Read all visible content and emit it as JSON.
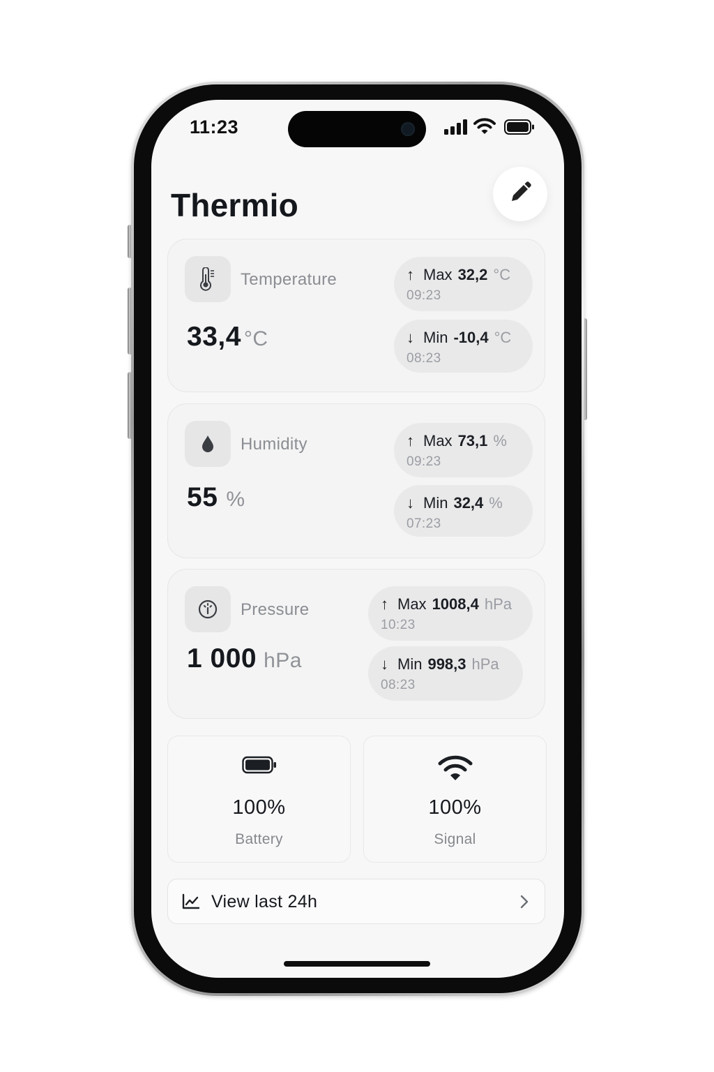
{
  "status_bar": {
    "time": "11:23"
  },
  "header": {
    "title": "Thermio",
    "edit_icon": "pencil-icon"
  },
  "metrics": {
    "temperature": {
      "label": "Temperature",
      "icon": "thermometer-icon",
      "value": "33,4",
      "unit": "°C",
      "max": {
        "label": "Max",
        "value": "32,2",
        "unit": "°C",
        "time": "09:23"
      },
      "min": {
        "label": "Min",
        "value": "-10,4",
        "unit": "°C",
        "time": "08:23"
      }
    },
    "humidity": {
      "label": "Humidity",
      "icon": "droplet-icon",
      "value": "55",
      "unit": "%",
      "max": {
        "label": "Max",
        "value": "73,1",
        "unit": "%",
        "time": "09:23"
      },
      "min": {
        "label": "Min",
        "value": "32,4",
        "unit": "%",
        "time": "07:23"
      }
    },
    "pressure": {
      "label": "Pressure",
      "icon": "gauge-icon",
      "value": "1 000",
      "unit": "hPa",
      "max": {
        "label": "Max",
        "value": "1008,4",
        "unit": "hPa",
        "time": "10:23"
      },
      "min": {
        "label": "Min",
        "value": "998,3",
        "unit": "hPa",
        "time": "08:23"
      }
    }
  },
  "device": {
    "battery": {
      "value": "100%",
      "label": "Battery",
      "icon": "battery-icon"
    },
    "signal": {
      "value": "100%",
      "label": "Signal",
      "icon": "wifi-icon"
    }
  },
  "history": {
    "label": "View last 24h",
    "icon": "line-chart-icon"
  },
  "colors": {
    "background": "#f7f7f7",
    "card": "#f4f4f4",
    "pill": "#e9e9ea",
    "text": "#15181d",
    "muted": "#8a8d92"
  }
}
